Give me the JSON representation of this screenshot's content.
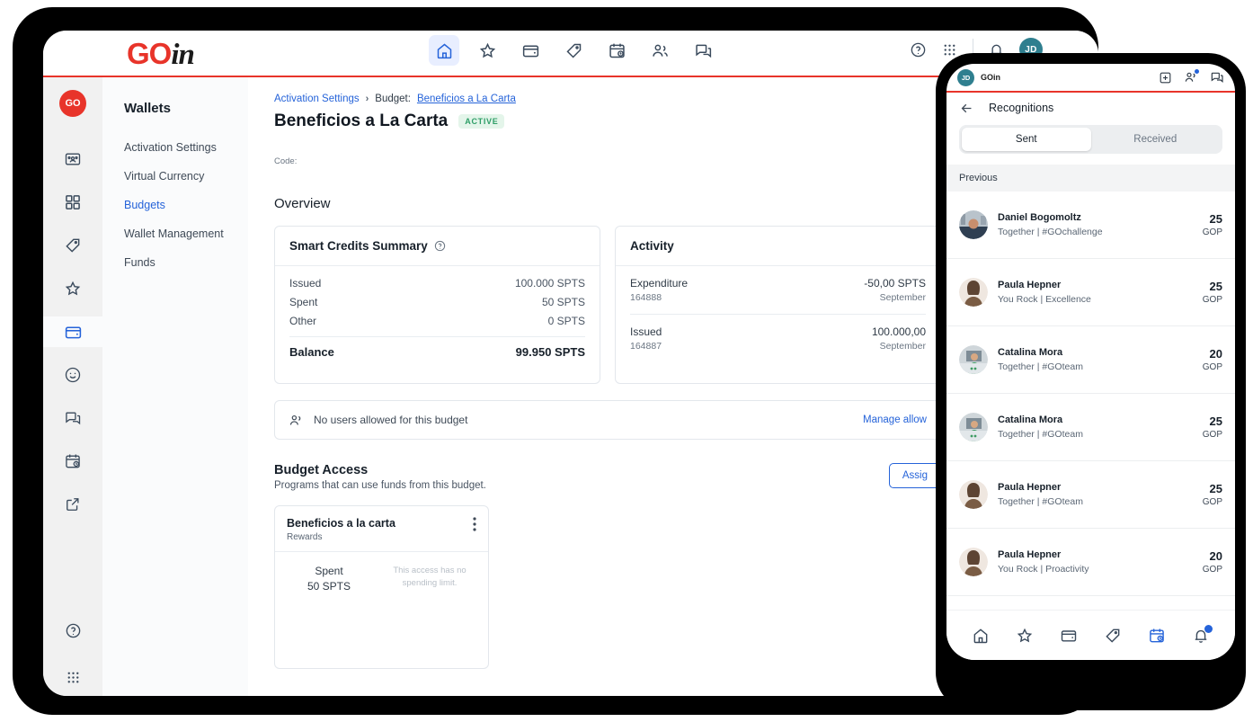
{
  "tablet": {
    "logo": {
      "go": "GO",
      "in": "in"
    },
    "topnav": [
      {
        "name": "home-icon",
        "active": true
      },
      {
        "name": "star-icon",
        "active": false
      },
      {
        "name": "wallet-icon",
        "active": false
      },
      {
        "name": "tag-icon",
        "active": false
      },
      {
        "name": "calendar-clock-icon",
        "active": false
      },
      {
        "name": "people-icon",
        "active": false
      },
      {
        "name": "chat-icon",
        "active": false
      }
    ],
    "topright": {
      "help": "help-icon",
      "apps": "apps-grid-icon",
      "bell": "bell-icon",
      "avatar": "JD"
    },
    "rail": {
      "logo": "GO"
    },
    "sidebar": {
      "title": "Wallets",
      "items": [
        {
          "label": "Activation Settings",
          "selected": false
        },
        {
          "label": "Virtual Currency",
          "selected": false
        },
        {
          "label": "Budgets",
          "selected": true
        },
        {
          "label": "Wallet Management",
          "selected": false
        },
        {
          "label": "Funds",
          "selected": false
        }
      ]
    },
    "breadcrumb": {
      "root": "Activation Settings",
      "sep": "›",
      "prefix": "Budget:",
      "current": "Beneficios a La Carta"
    },
    "page_title": "Beneficios a La Carta",
    "status_badge": "ACTIVE",
    "code_label": "Code:",
    "overview_title": "Overview",
    "summary_card": {
      "title": "Smart Credits Summary",
      "rows": [
        {
          "label": "Issued",
          "value": "100.000 SPTS"
        },
        {
          "label": "Spent",
          "value": "50 SPTS"
        },
        {
          "label": "Other",
          "value": "0 SPTS"
        }
      ],
      "total_label": "Balance",
      "total_value": "99.950 SPTS"
    },
    "activity_card": {
      "title": "Activity",
      "rows": [
        {
          "label": "Expenditure",
          "id": "164888",
          "amount": "-50,00 SPTS",
          "date": "September"
        },
        {
          "label": "Issued",
          "id": "164887",
          "amount": "100.000,00",
          "date": "September"
        }
      ]
    },
    "allowed_bar": {
      "text": "No users allowed for this budget",
      "link": "Manage allow"
    },
    "budget_access": {
      "title": "Budget Access",
      "subtitle": "Programs that can use funds from this budget.",
      "button": "Assig",
      "card": {
        "name": "Beneficios a la carta",
        "type": "Rewards",
        "spent_label": "Spent",
        "spent_value": "50 SPTS",
        "note": "This access has no spending limit."
      }
    }
  },
  "phone": {
    "header": {
      "avatar": "JD",
      "app": "GOin"
    },
    "back_title": "Recognitions",
    "tabs": [
      {
        "label": "Sent",
        "active": true
      },
      {
        "label": "Received",
        "active": false
      }
    ],
    "section_header": "Previous",
    "recognitions": [
      {
        "name": "Daniel Bogomoltz",
        "detail": "Together | #GOchallenge",
        "amount": "25",
        "unit": "GOP"
      },
      {
        "name": "Paula Hepner",
        "detail": "You Rock | Excellence",
        "amount": "25",
        "unit": "GOP"
      },
      {
        "name": "Catalina Mora",
        "detail": "Together | #GOteam",
        "amount": "20",
        "unit": "GOP"
      },
      {
        "name": "Catalina Mora",
        "detail": "Together | #GOteam",
        "amount": "25",
        "unit": "GOP"
      },
      {
        "name": "Paula Hepner",
        "detail": "Together | #GOteam",
        "amount": "25",
        "unit": "GOP"
      },
      {
        "name": "Paula Hepner",
        "detail": "You Rock | Proactivity",
        "amount": "20",
        "unit": "GOP"
      }
    ],
    "bottomnav": [
      {
        "name": "home-icon",
        "active": false
      },
      {
        "name": "star-icon",
        "active": false
      },
      {
        "name": "wallet-icon",
        "active": false
      },
      {
        "name": "tag-icon",
        "active": false
      },
      {
        "name": "calendar-clock-icon",
        "active": true
      },
      {
        "name": "bell-icon",
        "active": false,
        "badge": true
      }
    ]
  },
  "colors": {
    "brand_red": "#e8342a",
    "accent_blue": "#2563d9",
    "teal": "#2f7f8f",
    "green": "#2e9e67"
  }
}
